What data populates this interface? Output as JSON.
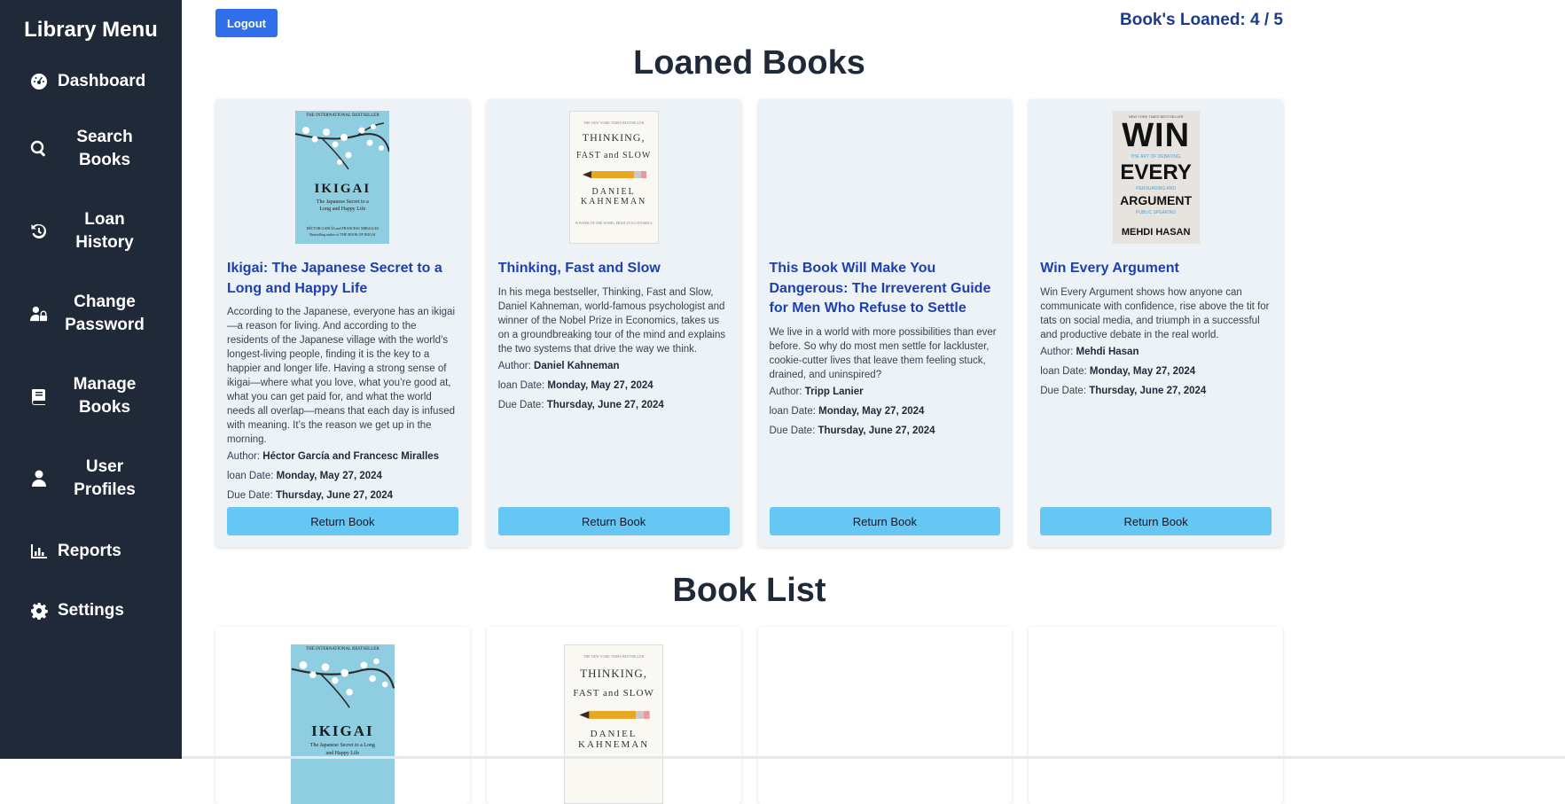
{
  "sidebar": {
    "title": "Library Menu",
    "items": [
      {
        "label": "Dashboard",
        "icon": "dashboard-icon"
      },
      {
        "label": "Search Books",
        "icon": "search-icon"
      },
      {
        "label": "Loan History",
        "icon": "history-icon"
      },
      {
        "label": "Change Password",
        "icon": "user-lock-icon"
      },
      {
        "label": "Manage Books",
        "icon": "book-icon"
      },
      {
        "label": "User Profiles",
        "icon": "user-icon"
      },
      {
        "label": "Reports",
        "icon": "chart-icon"
      },
      {
        "label": "Settings",
        "icon": "gear-icon"
      }
    ]
  },
  "header": {
    "logout_label": "Logout",
    "loan_count": "Book's Loaned: 4 / 5"
  },
  "loaned": {
    "title": "Loaned Books",
    "author_label": "Author:",
    "loan_date_label": "loan Date:",
    "due_date_label": "Due Date:",
    "return_label": "Return Book",
    "books": [
      {
        "title": "Ikigai: The Japanese Secret to a Long and Happy Life",
        "description": "According to the Japanese, everyone has an ikigai—a reason for living. And according to the residents of the Japanese village with the world’s longest-living people, finding it is the key to a happier and longer life. Having a strong sense of ikigai—where what you love, what you’re good at, what you can get paid for, and what the world needs all overlap—means that each day is infused with meaning. It’s the reason we get up in the morning.",
        "author": "Héctor García and Francesc Miralles",
        "loan_date": "Monday, May 27, 2024",
        "due_date": "Thursday, June 27, 2024",
        "cover": {
          "top": "THE INTERNATIONAL BESTSELLER",
          "main": "IKIGAI",
          "sub": "The Japanese Secret to a Long and Happy Life",
          "authors": "HÉCTOR GARCÍA and FRANCESC MIRALLES",
          "bottom": "Bestselling author of THE BOOK OF IKIGAI"
        }
      },
      {
        "title": "Thinking, Fast and Slow",
        "description": "In his mega bestseller, Thinking, Fast and Slow, Daniel Kahneman, world-famous psychologist and winner of the Nobel Prize in Economics, takes us on a groundbreaking tour of the mind and explains the two systems that drive the way we think.",
        "author": "Daniel Kahneman",
        "loan_date": "Monday, May 27, 2024",
        "due_date": "Thursday, June 27, 2024",
        "cover": {
          "top": "THE NEW YORK TIMES BESTSELLER",
          "line1": "THINKING,",
          "line2": "FAST and SLOW",
          "author": "DANIEL KAHNEMAN",
          "bottom": "WINNER OF THE NOBEL PRIZE IN ECONOMICS"
        }
      },
      {
        "title": "This Book Will Make You Dangerous: The Irreverent Guide for Men Who Refuse to Settle",
        "description": "We live in a world with more possibilities than ever before. So why do most men settle for lackluster, cookie-cutter lives that leave them feeling stuck, drained, and uninspired?",
        "author": "Tripp Lanier",
        "loan_date": "Monday, May 27, 2024",
        "due_date": "Thursday, June 27, 2024"
      },
      {
        "title": "Win Every Argument",
        "description": "Win Every Argument shows how anyone can communicate with confidence, rise above the tit for tats on social media, and triumph in a successful and productive debate in the real world.",
        "author": "Mehdi Hasan",
        "loan_date": "Monday, May 27, 2024",
        "due_date": "Thursday, June 27, 2024",
        "cover": {
          "top": "NEW YORK TIMES BESTSELLER",
          "w1": "WIN",
          "w2": "EVERY",
          "s1": "THE ART OF DEBATING,",
          "s2": "PERSUADING AND",
          "s3": "PUBLIC SPEAKING",
          "w3": "ARGUMENT",
          "author": "MEHDI HASAN"
        }
      }
    ]
  },
  "book_list": {
    "title": "Book List"
  }
}
